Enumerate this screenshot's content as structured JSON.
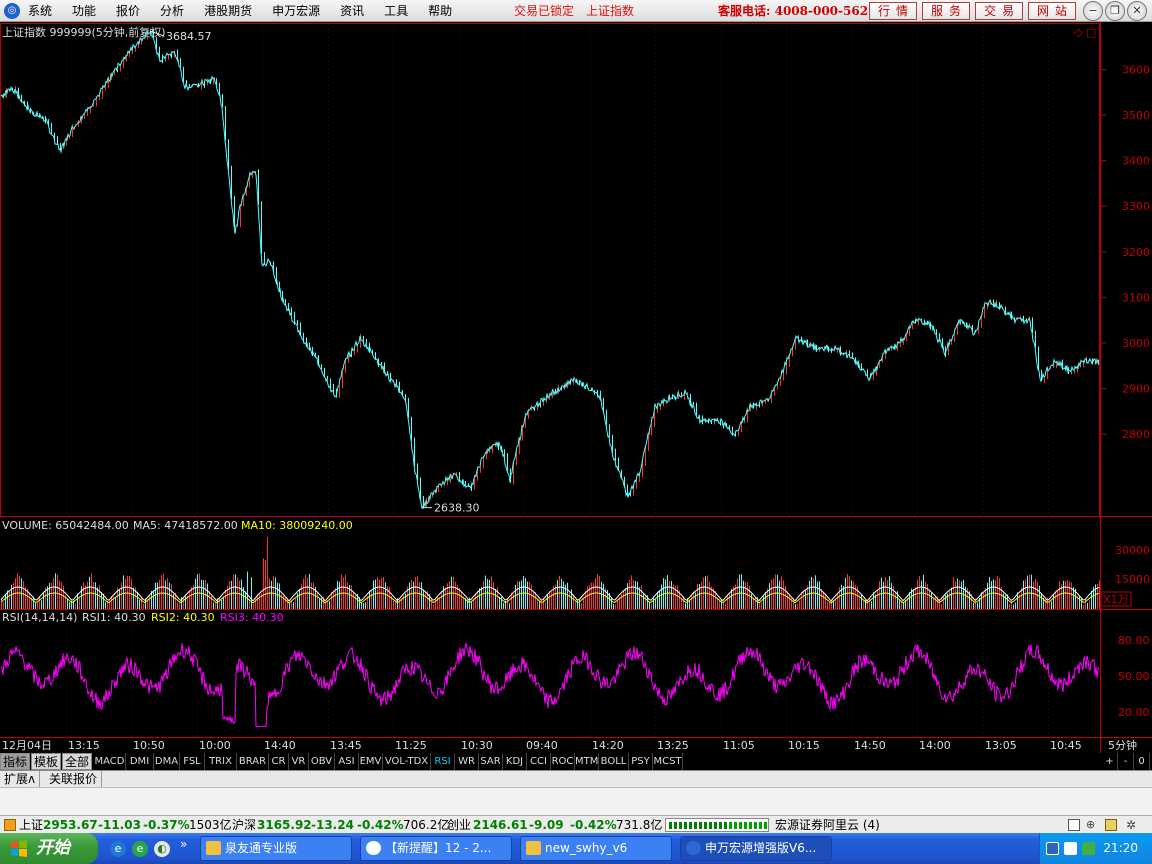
{
  "menubar": {
    "items": [
      "系统",
      "功能",
      "报价",
      "分析",
      "港股期货",
      "申万宏源",
      "资讯",
      "工具",
      "帮助"
    ],
    "lock_status": "交易已锁定",
    "current_index": "上证指数",
    "hotline": "客服电话: 4008-000-562",
    "buttons": [
      "行情",
      "服务",
      "交易",
      "网站"
    ]
  },
  "chart": {
    "title": "上证指数 999999(5分钟,前复权)",
    "high_label": "3684.57",
    "low_label": "2638.30",
    "volume_header": {
      "volume": "VOLUME: 65042484.00",
      "ma5": "MA5: 47418572.00",
      "ma10": "MA10: 38009240.00"
    },
    "volume_unit": "X1万",
    "rsi_header": {
      "name": "RSI(14,14,14)",
      "rsi1": "RSI1: 40.30",
      "rsi2": "RSI2: 40.30",
      "rsi3": "RSI3: 40.30"
    },
    "period_label": "5分钟",
    "colors": {
      "up": "#ff3030",
      "down": "#54ffff",
      "rsi": "#ff00ff",
      "ma5": "#ffffff",
      "ma10": "#ffff00",
      "frame": "#c00000"
    }
  },
  "chart_data": {
    "type": "line",
    "price_axis": {
      "ticks": [
        3600,
        3500,
        3400,
        3300,
        3200,
        3100,
        3000,
        2900,
        2800
      ],
      "ylim": [
        2620,
        3700
      ]
    },
    "volume_axis": {
      "ticks": [
        "30000",
        "15000"
      ]
    },
    "rsi_axis": {
      "ticks": [
        "80.00",
        "50.00",
        "20.00"
      ]
    },
    "x_tick_labels": [
      "12月04日",
      "13:15",
      "10:50",
      "10:00",
      "14:40",
      "13:45",
      "11:25",
      "10:30",
      "09:40",
      "14:20",
      "13:25",
      "11:05",
      "10:15",
      "14:50",
      "14:00",
      "13:05",
      "10:45"
    ],
    "price_path": [
      [
        0,
        3540
      ],
      [
        12,
        3560
      ],
      [
        30,
        3510
      ],
      [
        45,
        3490
      ],
      [
        60,
        3420
      ],
      [
        72,
        3470
      ],
      [
        90,
        3520
      ],
      [
        110,
        3580
      ],
      [
        125,
        3630
      ],
      [
        140,
        3665
      ],
      [
        150,
        3684.57
      ],
      [
        160,
        3620
      ],
      [
        175,
        3640
      ],
      [
        185,
        3560
      ],
      [
        200,
        3570
      ],
      [
        215,
        3580
      ],
      [
        222,
        3520
      ],
      [
        228,
        3380
      ],
      [
        235,
        3240
      ],
      [
        240,
        3300
      ],
      [
        250,
        3370
      ],
      [
        256,
        3370
      ],
      [
        262,
        3170
      ],
      [
        270,
        3180
      ],
      [
        282,
        3100
      ],
      [
        300,
        3020
      ],
      [
        320,
        2950
      ],
      [
        335,
        2880
      ],
      [
        345,
        2960
      ],
      [
        360,
        3010
      ],
      [
        375,
        2970
      ],
      [
        390,
        2920
      ],
      [
        405,
        2880
      ],
      [
        415,
        2720
      ],
      [
        422,
        2638.3
      ],
      [
        440,
        2690
      ],
      [
        455,
        2710
      ],
      [
        470,
        2680
      ],
      [
        485,
        2760
      ],
      [
        500,
        2780
      ],
      [
        510,
        2700
      ],
      [
        525,
        2840
      ],
      [
        545,
        2880
      ],
      [
        560,
        2900
      ],
      [
        575,
        2920
      ],
      [
        590,
        2900
      ],
      [
        600,
        2880
      ],
      [
        612,
        2760
      ],
      [
        628,
        2660
      ],
      [
        640,
        2720
      ],
      [
        655,
        2860
      ],
      [
        670,
        2880
      ],
      [
        685,
        2890
      ],
      [
        700,
        2830
      ],
      [
        720,
        2830
      ],
      [
        735,
        2800
      ],
      [
        750,
        2860
      ],
      [
        770,
        2880
      ],
      [
        785,
        2950
      ],
      [
        795,
        3010
      ],
      [
        815,
        2990
      ],
      [
        835,
        2990
      ],
      [
        855,
        2960
      ],
      [
        870,
        2920
      ],
      [
        885,
        2980
      ],
      [
        900,
        3000
      ],
      [
        915,
        3050
      ],
      [
        930,
        3040
      ],
      [
        945,
        2980
      ],
      [
        960,
        3050
      ],
      [
        975,
        3020
      ],
      [
        985,
        3090
      ],
      [
        1000,
        3080
      ],
      [
        1015,
        3050
      ],
      [
        1030,
        3050
      ],
      [
        1040,
        2920
      ],
      [
        1055,
        2960
      ],
      [
        1070,
        2940
      ],
      [
        1085,
        2960
      ],
      [
        1100,
        2960
      ]
    ]
  },
  "indicator_tabs": [
    "MACD",
    "DMI",
    "DMA",
    "FSL",
    "TRIX",
    "BRAR",
    "CR",
    "VR",
    "OBV",
    "ASI",
    "EMV",
    "VOL-TDX",
    "RSI",
    "WR",
    "SAR",
    "KDJ",
    "CCI",
    "ROC",
    "MTM",
    "BOLL",
    "PSY",
    "MCST"
  ],
  "active_indicator": "RSI",
  "main_tabs": [
    "指标",
    "模板",
    "全部"
  ],
  "sub_tabs": [
    "扩展ʌ",
    "关联报价"
  ],
  "right_controls": [
    "+",
    "-",
    "0"
  ],
  "statusbar": {
    "sh_name": "上证",
    "sh_value": "2953.67",
    "sh_change": "-11.03",
    "sh_pct": "-0.37%",
    "sh_amount": "1503亿",
    "hs_name": "沪深",
    "hs_value": "3165.92",
    "hs_change": "-13.24",
    "hs_pct": "-0.42%",
    "hs_amount": "706.2亿",
    "cy_name": "创业",
    "cy_value": "2146.61",
    "cy_change": "-9.09",
    "cy_pct": "-0.42%",
    "cy_amount": "731.8亿",
    "server": "宏源证券阿里云 (4)"
  },
  "taskbar": {
    "start": "开始",
    "tasks": [
      "泉友通专业版",
      "【新提醒】12 - 2...",
      "new_swhy_v6",
      "申万宏源增强版V6..."
    ],
    "clock": "21:20"
  }
}
